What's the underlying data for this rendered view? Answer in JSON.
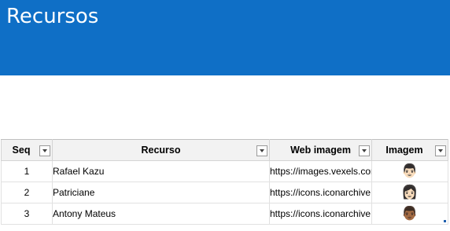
{
  "banner": {
    "title": "Recursos",
    "color": "#0f6fc6"
  },
  "table": {
    "headers": {
      "seq": "Seq",
      "recurso": "Recurso",
      "web_imagem": "Web imagem",
      "imagem": "Imagem"
    },
    "rows": [
      {
        "seq": "1",
        "recurso": "Rafael Kazu",
        "web_imagem": "https://images.vexels.com",
        "imagem": "👨🏻",
        "imagem_icon": "man-avatar-icon"
      },
      {
        "seq": "2",
        "recurso": "Patriciane",
        "web_imagem": "https://icons.iconarchive.com",
        "imagem": "👩🏻",
        "imagem_icon": "woman-avatar-icon"
      },
      {
        "seq": "3",
        "recurso": "Antony Mateus",
        "web_imagem": "https://icons.iconarchive.com",
        "imagem": "👨🏾",
        "imagem_icon": "man-dark-avatar-icon"
      }
    ]
  }
}
